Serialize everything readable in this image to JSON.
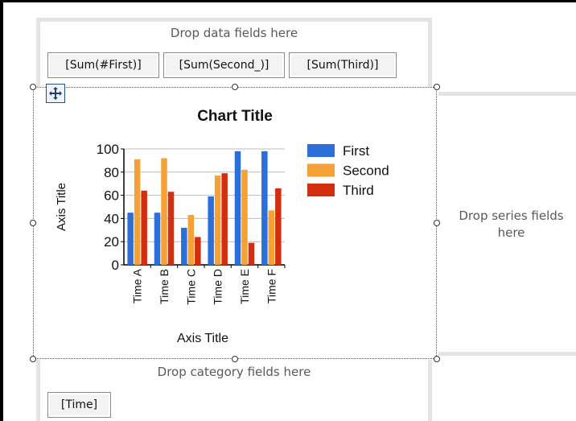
{
  "drop_zones": {
    "data": "Drop data fields here",
    "series": "Drop series fields here",
    "series_lines": [
      "Drop series fields",
      "here"
    ],
    "category": "Drop category fields here"
  },
  "data_fields": [
    {
      "label": "[Sum(#First)]"
    },
    {
      "label": "[Sum(Second_)]"
    },
    {
      "label": "[Sum(Third)]"
    }
  ],
  "category_fields": [
    {
      "label": "[Time]"
    }
  ],
  "colors": {
    "first": "#2c6fd8",
    "second": "#f5a136",
    "third": "#d42e10"
  },
  "icons": {
    "move": "move-arrows-icon"
  },
  "chart_data": {
    "type": "bar",
    "title": "Chart Title",
    "xlabel": "Axis Title",
    "ylabel": "Axis Title",
    "categories": [
      "Time A",
      "Time B",
      "Time C",
      "Time D",
      "Time E",
      "Time F"
    ],
    "series": [
      {
        "name": "First",
        "values": [
          45,
          45,
          32,
          59,
          98,
          98
        ]
      },
      {
        "name": "Second",
        "values": [
          91,
          92,
          43,
          77,
          82,
          47
        ]
      },
      {
        "name": "Third",
        "values": [
          64,
          63,
          24,
          79,
          19,
          66
        ]
      }
    ],
    "ylim": [
      0,
      100
    ],
    "yticks": [
      "0",
      "20",
      "40",
      "60",
      "80",
      "100"
    ],
    "grid": true,
    "legend": "right"
  }
}
